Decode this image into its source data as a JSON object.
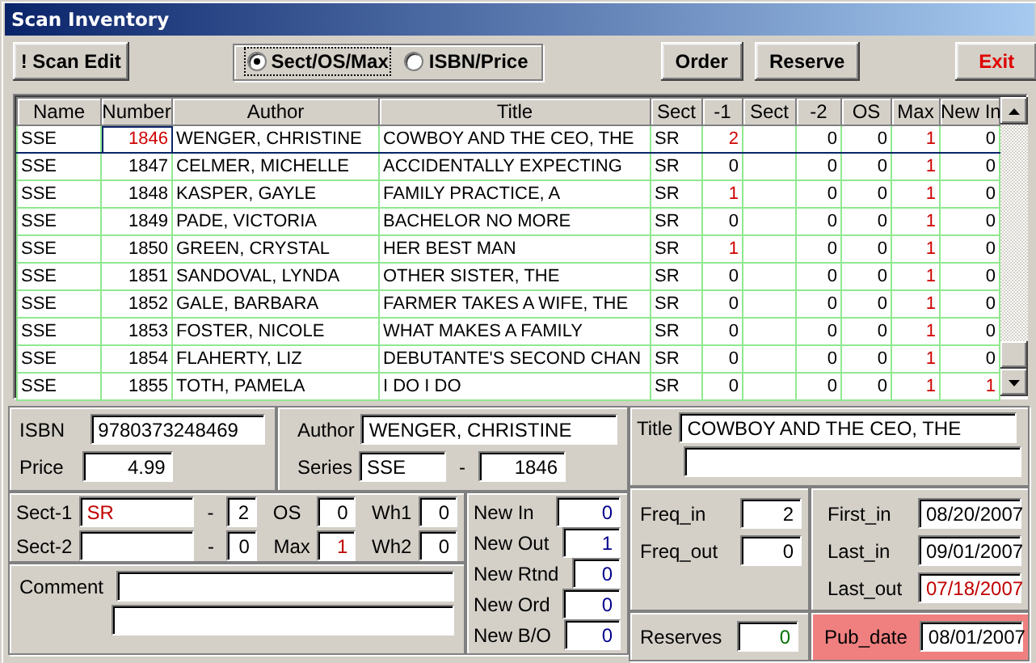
{
  "window": {
    "title": "Scan Inventory"
  },
  "toolbar": {
    "buttons": [
      {
        "label": "! Scan Edit",
        "kind": "normal"
      },
      {
        "label": "Order",
        "kind": "normal"
      },
      {
        "label": "Reserve",
        "kind": "normal"
      },
      {
        "label": "Exit",
        "kind": "exit"
      }
    ],
    "view_options": [
      {
        "label": "Sect/OS/Max",
        "selected": true
      },
      {
        "label": "ISBN/Price",
        "selected": false
      }
    ]
  },
  "grid": {
    "columns": [
      "Name",
      "Number",
      "Author",
      "Title",
      "Sect",
      "-1",
      "Sect",
      "-2",
      "OS",
      "Max",
      "New In"
    ],
    "rows": [
      {
        "selected": true,
        "minus1_alert": true,
        "new_in_alert": false,
        "cells": [
          "SSE",
          "1846",
          "WENGER, CHRISTINE",
          "COWBOY AND THE CEO, THE",
          "SR",
          "2",
          "",
          "0",
          "0",
          "1",
          "0"
        ]
      },
      {
        "selected": false,
        "minus1_alert": false,
        "new_in_alert": false,
        "cells": [
          "SSE",
          "1847",
          "CELMER, MICHELLE",
          "ACCIDENTALLY EXPECTING",
          "SR",
          "0",
          "",
          "0",
          "0",
          "1",
          "0"
        ]
      },
      {
        "selected": false,
        "minus1_alert": true,
        "new_in_alert": false,
        "cells": [
          "SSE",
          "1848",
          "KASPER, GAYLE",
          "FAMILY PRACTICE, A",
          "SR",
          "1",
          "",
          "0",
          "0",
          "1",
          "0"
        ]
      },
      {
        "selected": false,
        "minus1_alert": false,
        "new_in_alert": false,
        "cells": [
          "SSE",
          "1849",
          "PADE, VICTORIA",
          "BACHELOR NO MORE",
          "SR",
          "0",
          "",
          "0",
          "0",
          "1",
          "0"
        ]
      },
      {
        "selected": false,
        "minus1_alert": true,
        "new_in_alert": false,
        "cells": [
          "SSE",
          "1850",
          "GREEN, CRYSTAL",
          "HER BEST MAN",
          "SR",
          "1",
          "",
          "0",
          "0",
          "1",
          "0"
        ]
      },
      {
        "selected": false,
        "minus1_alert": false,
        "new_in_alert": false,
        "cells": [
          "SSE",
          "1851",
          "SANDOVAL, LYNDA",
          "OTHER SISTER, THE",
          "SR",
          "0",
          "",
          "0",
          "0",
          "1",
          "0"
        ]
      },
      {
        "selected": false,
        "minus1_alert": false,
        "new_in_alert": false,
        "cells": [
          "SSE",
          "1852",
          "GALE, BARBARA",
          "FARMER TAKES A WIFE, THE",
          "SR",
          "0",
          "",
          "0",
          "0",
          "1",
          "0"
        ]
      },
      {
        "selected": false,
        "minus1_alert": false,
        "new_in_alert": false,
        "cells": [
          "SSE",
          "1853",
          "FOSTER, NICOLE",
          "WHAT MAKES A FAMILY",
          "SR",
          "0",
          "",
          "0",
          "0",
          "1",
          "0"
        ]
      },
      {
        "selected": false,
        "minus1_alert": false,
        "new_in_alert": false,
        "cells": [
          "SSE",
          "1854",
          "FLAHERTY, LIZ",
          "DEBUTANTE'S SECOND CHAN",
          "SR",
          "0",
          "",
          "0",
          "0",
          "1",
          "0"
        ]
      },
      {
        "selected": false,
        "minus1_alert": false,
        "new_in_alert": true,
        "cells": [
          "SSE",
          "1855",
          "TOTH, PAMELA",
          "I DO I DO",
          "SR",
          "0",
          "",
          "0",
          "0",
          "1",
          "1"
        ]
      }
    ]
  },
  "details": {
    "isbn": {
      "label": "ISBN",
      "value": "9780373248469"
    },
    "price": {
      "label": "Price",
      "value": "4.99"
    },
    "author": {
      "label": "Author",
      "value": "WENGER, CHRISTINE"
    },
    "series": {
      "label": "Series",
      "value": "SSE",
      "separator": "-",
      "number": "1846"
    },
    "title": {
      "label": "Title",
      "value": "COWBOY AND THE CEO, THE"
    },
    "sect_1": {
      "label": "Sect-1",
      "value": "SR",
      "separator": "-",
      "qty": "2"
    },
    "sect_2": {
      "label": "Sect-2",
      "separator": "-",
      "qty": "0"
    },
    "os": {
      "label": "OS",
      "value": "0"
    },
    "max": {
      "label": "Max",
      "value": "1"
    },
    "wh1": {
      "label": "Wh1",
      "value": "0"
    },
    "wh2": {
      "label": "Wh2",
      "value": "0"
    },
    "new_counts": [
      {
        "label": "New In",
        "value": "0"
      },
      {
        "label": "New Out",
        "value": "1"
      },
      {
        "label": "New Rtnd",
        "value": "0"
      },
      {
        "label": "New Ord",
        "value": "0"
      },
      {
        "label": "New B/O",
        "value": "0"
      }
    ],
    "comment": {
      "label": "Comment"
    },
    "freq_in": {
      "label": "Freq_in",
      "value": "2"
    },
    "freq_out": {
      "label": "Freq_out",
      "value": "0"
    },
    "first_in": {
      "label": "First_in",
      "value": "08/20/2007"
    },
    "last_in": {
      "label": "Last_in",
      "value": "09/01/2007"
    },
    "last_out": {
      "label": "Last_out",
      "value": "07/18/2007"
    },
    "reserves": {
      "label": "Reserves",
      "value": "0"
    },
    "pub_date": {
      "label": "Pub_date",
      "value": "08/01/2007"
    }
  }
}
